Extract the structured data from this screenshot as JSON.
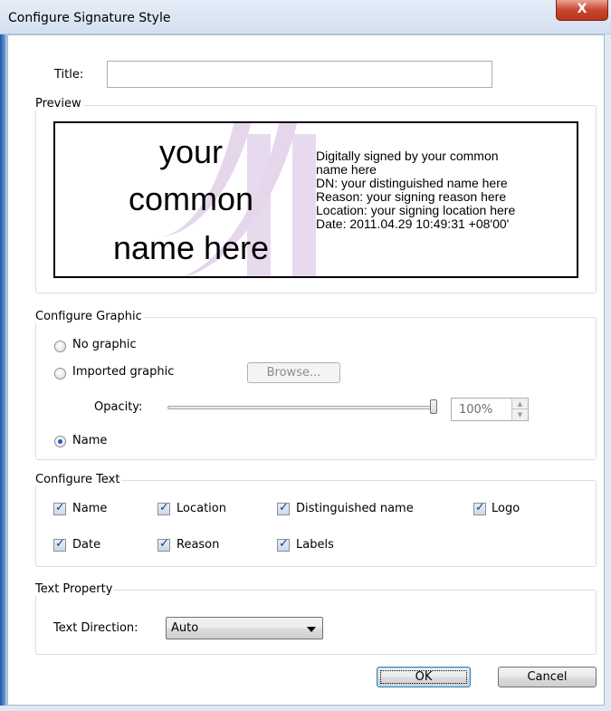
{
  "window": {
    "title": "Configure Signature Style",
    "close_label": "X"
  },
  "title_field": {
    "label": "Title:",
    "value": ""
  },
  "preview": {
    "group_label": "Preview",
    "name_lines": [
      "your",
      "common",
      "name here"
    ],
    "details": [
      "Digitally signed by your common",
      "name here",
      "DN: your distinguished name here",
      "Reason: your signing reason here",
      "Location: your signing location here",
      "Date: 2011.04.29 10:49:31 +08'00'"
    ]
  },
  "configure_graphic": {
    "group_label": "Configure Graphic",
    "no_graphic": "No graphic",
    "imported_graphic": "Imported graphic",
    "browse": "Browse...",
    "opacity_label": "Opacity:",
    "opacity_value": "100%",
    "opacity_level": 1.0,
    "name": "Name",
    "selected": "name"
  },
  "configure_text": {
    "group_label": "Configure Text",
    "options": {
      "name": "Name",
      "location": "Location",
      "distinguished_name": "Distinguished name",
      "logo": "Logo",
      "date": "Date",
      "reason": "Reason",
      "labels": "Labels"
    },
    "checked": [
      "name",
      "location",
      "distinguished_name",
      "logo",
      "date",
      "reason",
      "labels"
    ]
  },
  "text_property": {
    "group_label": "Text Property",
    "direction_label": "Text Direction:",
    "direction_value": "Auto"
  },
  "buttons": {
    "ok": "OK",
    "cancel": "Cancel"
  },
  "colors": {
    "accent": "#1b5fbf",
    "watermark": "#e5d6ec",
    "close_red": "#c7472f"
  }
}
